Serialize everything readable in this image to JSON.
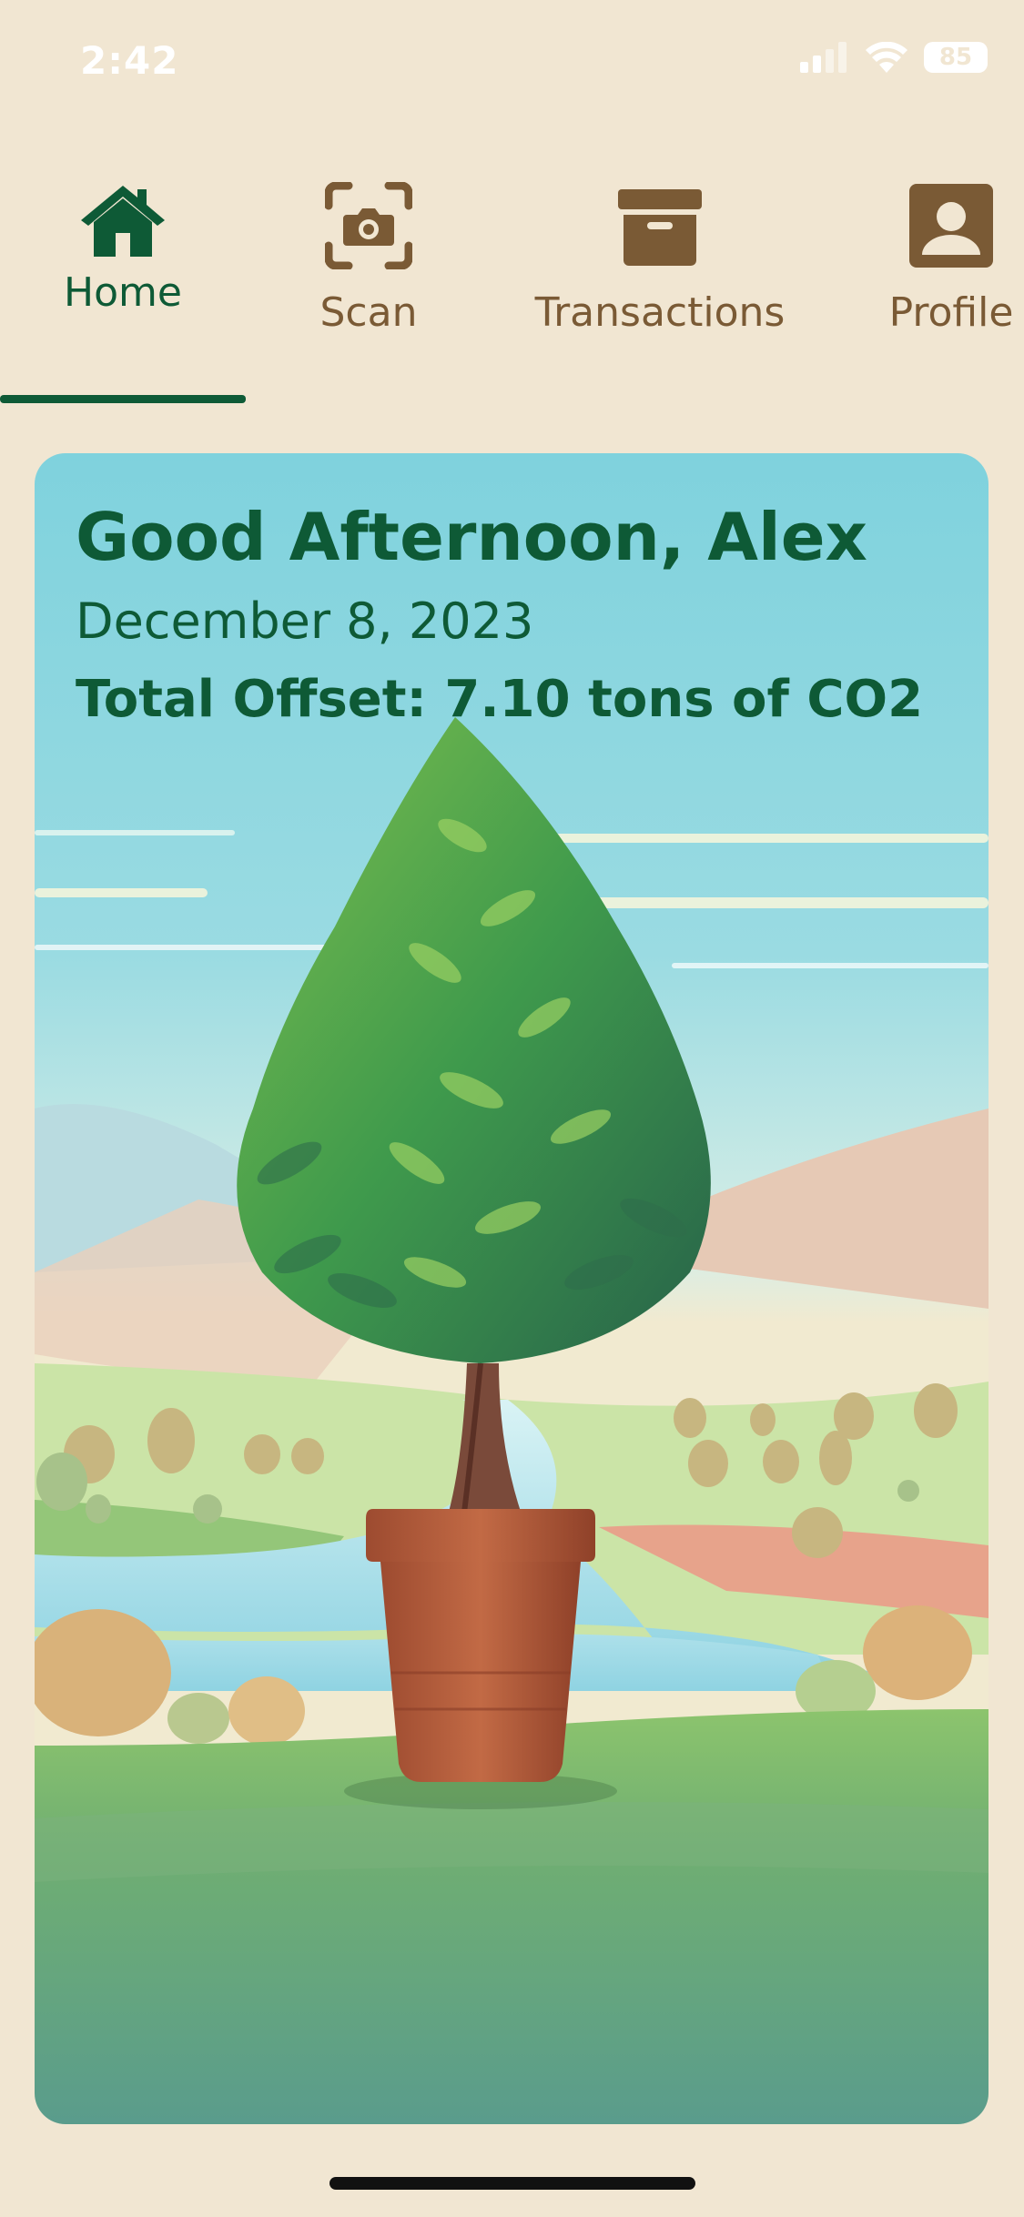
{
  "status_bar": {
    "time": "2:42",
    "battery": "85"
  },
  "nav": {
    "items": [
      {
        "label": "Home",
        "icon": "home-icon",
        "active": true
      },
      {
        "label": "Scan",
        "icon": "camera-scan-icon"
      },
      {
        "label": "Transactions",
        "icon": "archive-box-icon"
      },
      {
        "label": "Profile",
        "icon": "user-profile-icon"
      }
    ]
  },
  "card": {
    "greeting": "Good Afternoon, Alex",
    "date": "December 8, 2023",
    "total_offset": "Total Offset: 7.10 tons of CO2"
  },
  "colors": {
    "background": "#f1e6d2",
    "primary": "#0e5a36",
    "secondary": "#7a5a35"
  }
}
